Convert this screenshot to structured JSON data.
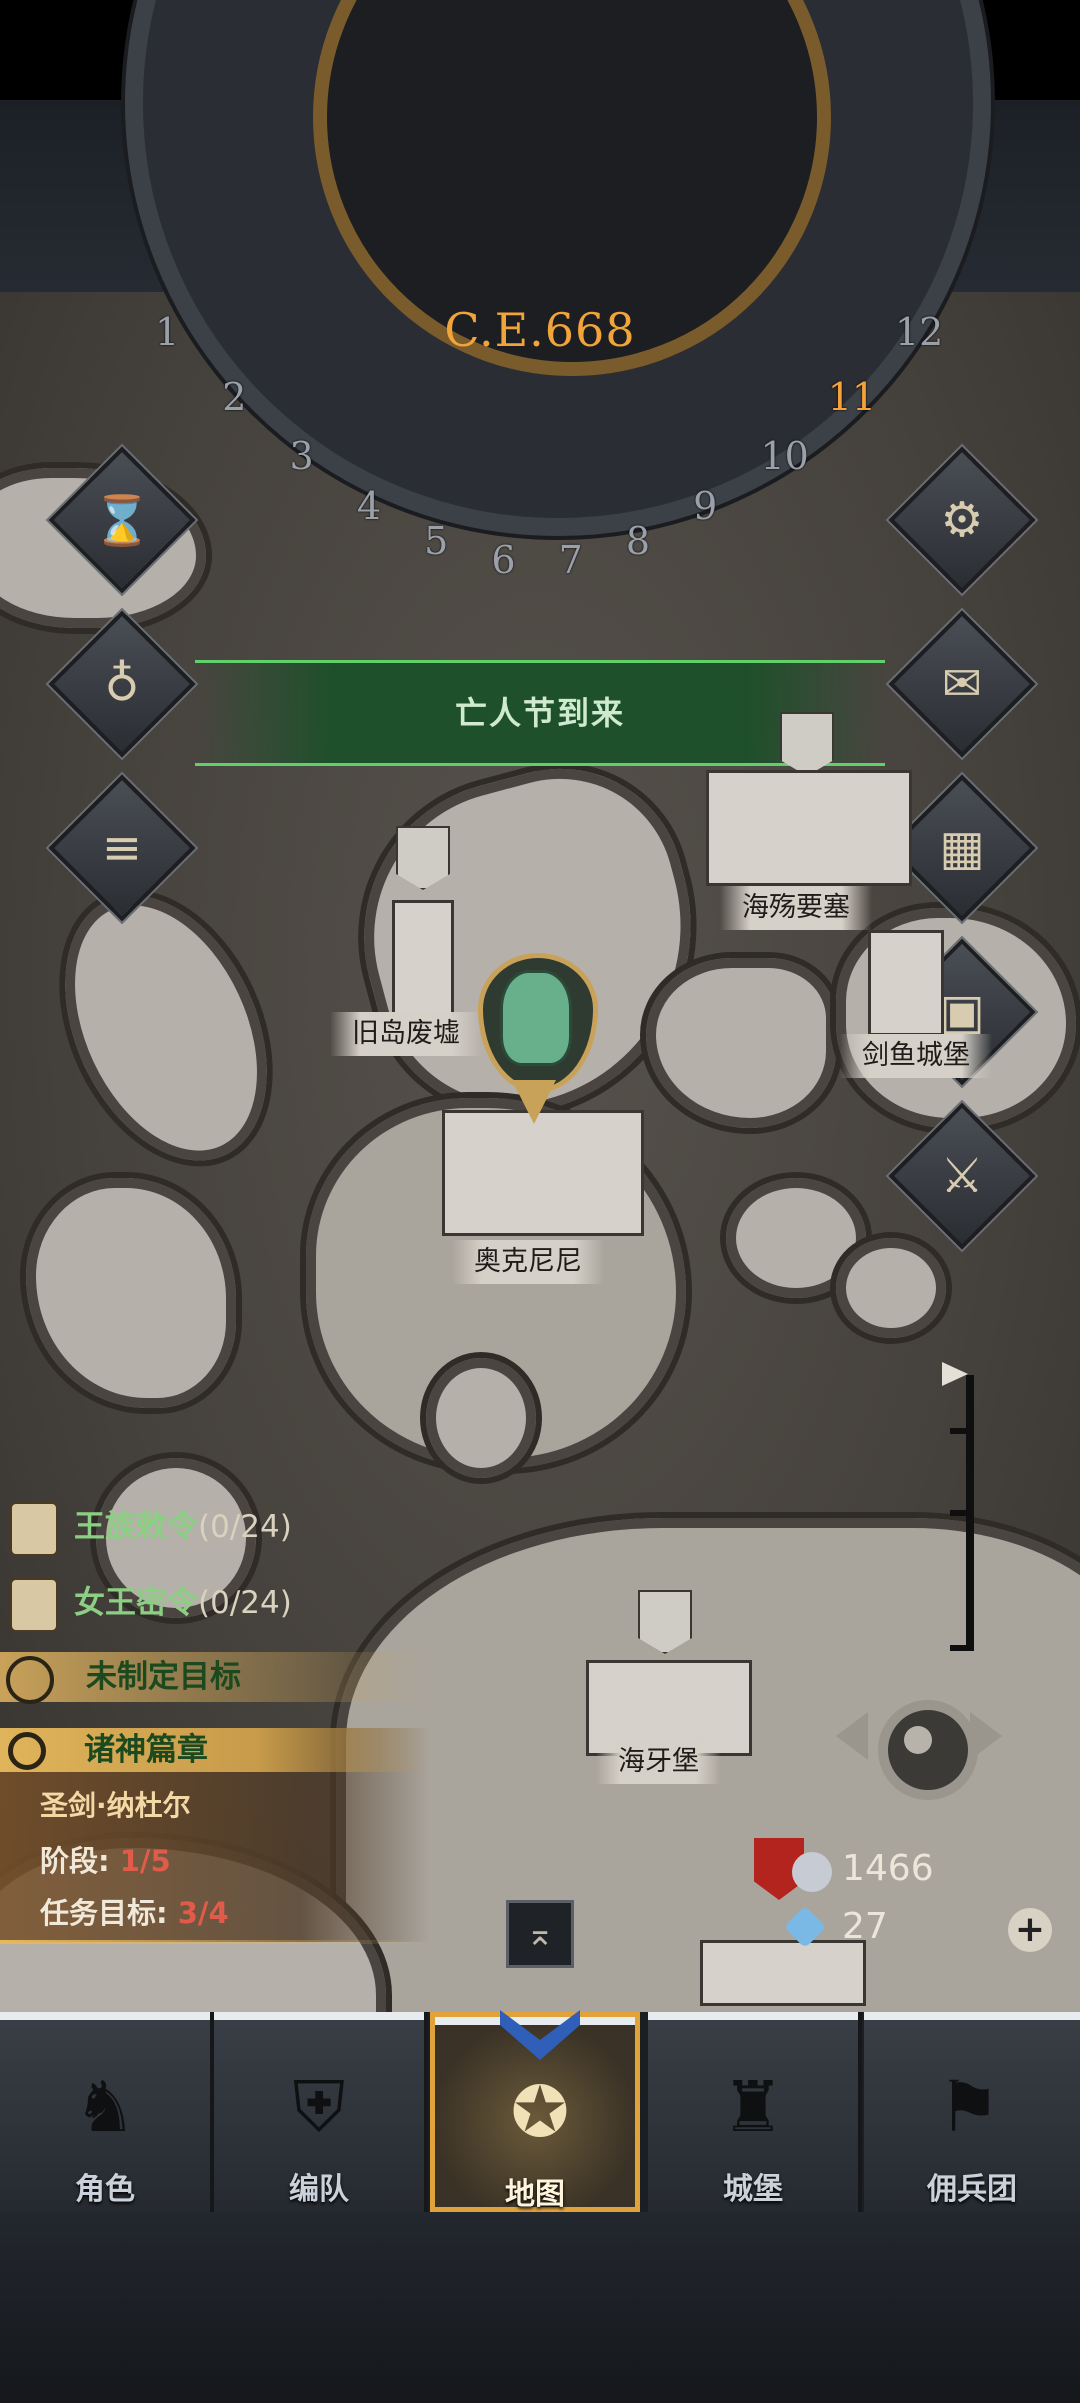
{
  "calendar": {
    "year": "C.E.668",
    "months": [
      "1",
      "2",
      "3",
      "4",
      "5",
      "6",
      "7",
      "8",
      "9",
      "10",
      "11",
      "12"
    ],
    "current_month": "11"
  },
  "event_banner": {
    "text": "亡人节到来"
  },
  "locations": {
    "old_island_ruins": "旧岛废墟",
    "sea_fortress": "海殇要塞",
    "swordfish_castle": "剑鱼城堡",
    "oakenini": "奥克尼尼",
    "seatooth_keep": "海牙堡"
  },
  "quests": {
    "royal_decree": {
      "label": "王族敕令",
      "count": "(0/24)"
    },
    "queen_secret": {
      "label": "女王密令",
      "count": "(0/24)"
    },
    "target": {
      "label": "未制定目标"
    },
    "chapter": {
      "title": "诸神篇章",
      "subtitle": "圣剑·纳杜尔",
      "stage_label": "阶段:",
      "stage_value": "1/5",
      "goal_label": "任务目标:",
      "goal_value": "3/4"
    }
  },
  "resources": {
    "silver": "1466",
    "gems": "27"
  },
  "side_buttons": {
    "left": [
      "hourglass-icon",
      "money-bag-icon",
      "scroll-icon"
    ],
    "right": [
      "gear-icon",
      "mail-icon",
      "grid-icon",
      "supplies-icon",
      "mercenary-icon"
    ]
  },
  "nav": {
    "items": [
      "角色",
      "编队",
      "地图",
      "城堡",
      "佣兵团"
    ],
    "active": "地图"
  },
  "colors": {
    "accent_gold": "#e0a23a",
    "quest_green": "#8ccf84",
    "stage_red": "#e15b4a"
  }
}
